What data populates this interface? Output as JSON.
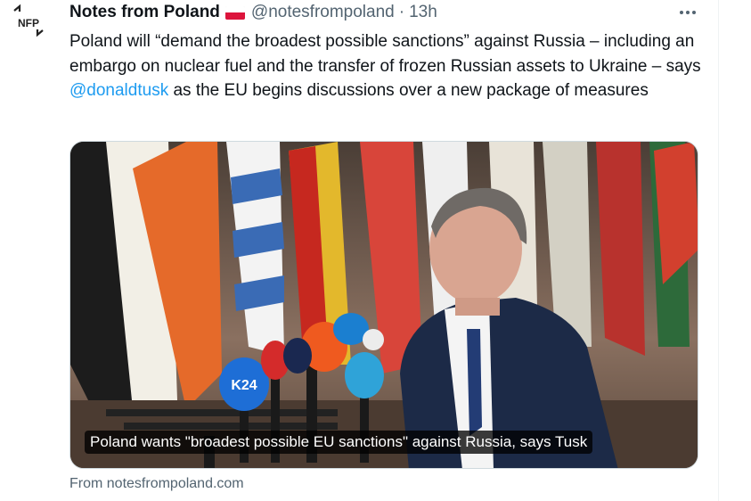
{
  "tweet": {
    "author_name": "Notes from Poland",
    "avatar_text": "NFP",
    "handle": "@notesfrompoland",
    "separator": "·",
    "time": "13h",
    "text_before_mention": "Poland will “demand the broadest possible sanctions” against Russia – including an embargo on nuclear fuel and the transfer of frozen Russian assets to Ukraine – says ",
    "mention": "@donaldtusk",
    "text_after_mention": " as the EU begins discussions over a new package of measures",
    "media_caption": "Poland wants \"broadest possible EU sanctions\" against Russia, says Tusk",
    "microphone_logo": "K24",
    "source": "From notesfrompoland.com"
  },
  "icons": {
    "avatar": "nfp-logo",
    "flag": "poland-flag-icon",
    "more": "more-icon"
  },
  "colors": {
    "text_primary": "#0f1419",
    "text_secondary": "#536471",
    "link": "#1d9bf0",
    "flag_red": "#dc143c"
  }
}
